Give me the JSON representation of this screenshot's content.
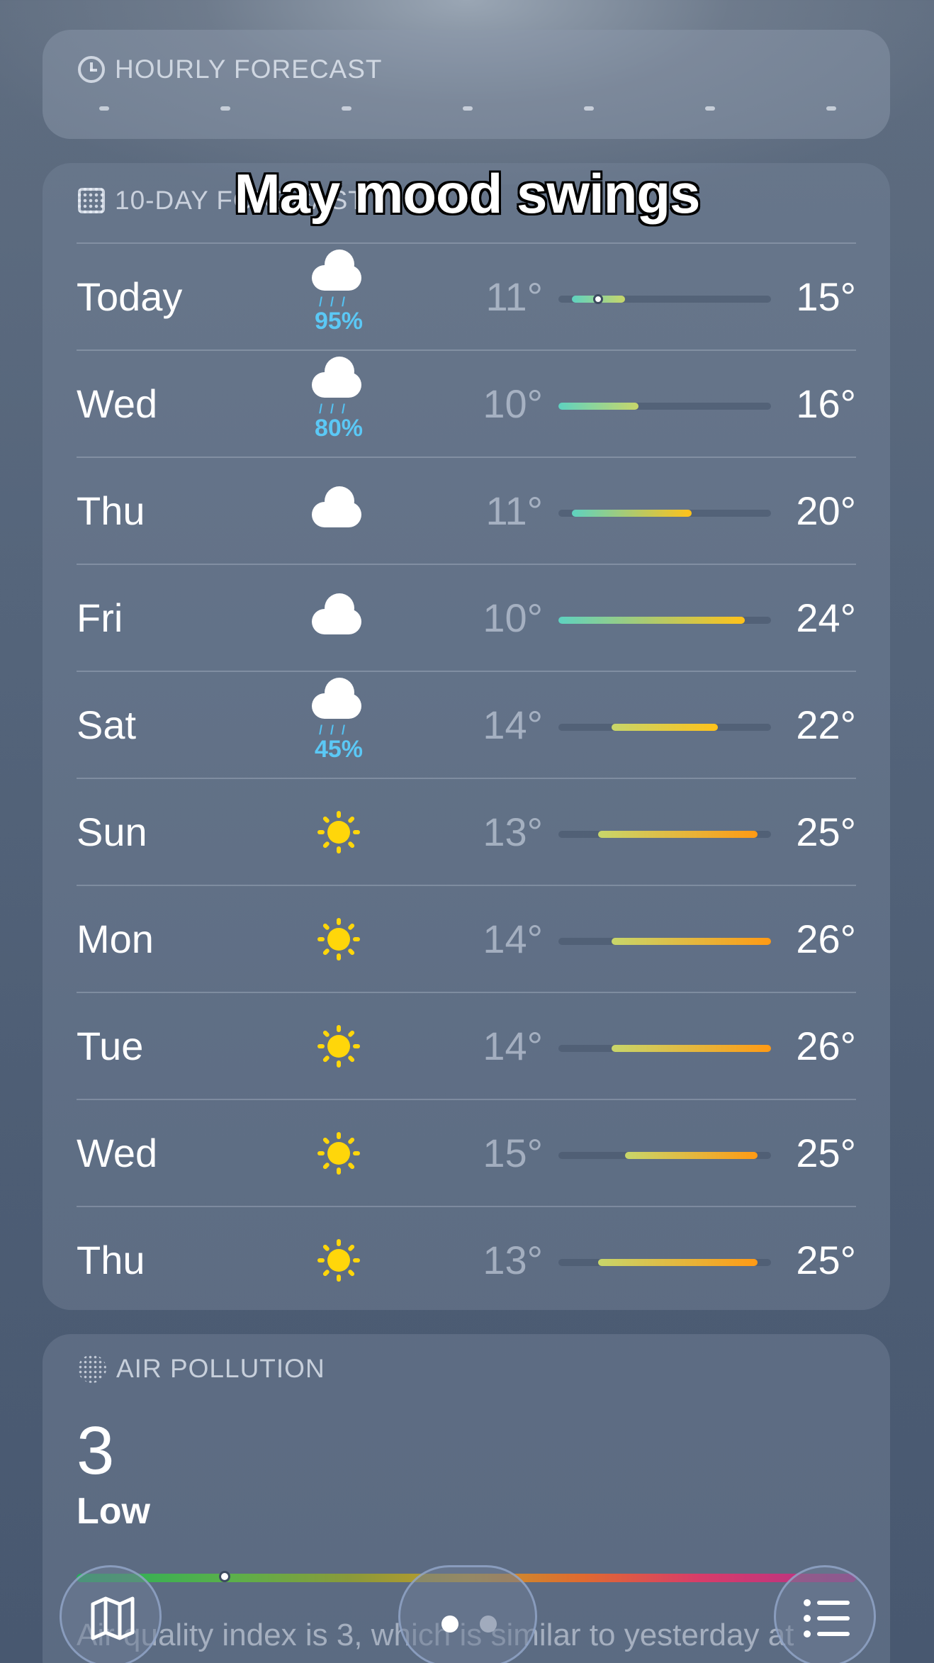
{
  "overlay": {
    "caption": "May mood swings"
  },
  "hourly": {
    "header": "HOURLY FORECAST",
    "icon": "clock-icon"
  },
  "daily": {
    "header": "10-DAY FORECAST",
    "icon": "calendar-icon",
    "scale": {
      "min": 10,
      "max": 26
    },
    "days": [
      {
        "day": "Today",
        "icon": "cloud-rain-icon",
        "precip": "95%",
        "low": "11°",
        "high": "15°",
        "low_value": 11,
        "high_value": 15,
        "current": 13
      },
      {
        "day": "Wed",
        "icon": "cloud-rain-icon",
        "precip": "80%",
        "low": "10°",
        "high": "16°",
        "low_value": 10,
        "high_value": 16
      },
      {
        "day": "Thu",
        "icon": "cloud-icon",
        "precip": "",
        "low": "11°",
        "high": "20°",
        "low_value": 11,
        "high_value": 20
      },
      {
        "day": "Fri",
        "icon": "cloud-icon",
        "precip": "",
        "low": "10°",
        "high": "24°",
        "low_value": 10,
        "high_value": 24
      },
      {
        "day": "Sat",
        "icon": "cloud-rain-icon",
        "precip": "45%",
        "low": "14°",
        "high": "22°",
        "low_value": 14,
        "high_value": 22
      },
      {
        "day": "Sun",
        "icon": "sun-icon",
        "precip": "",
        "low": "13°",
        "high": "25°",
        "low_value": 13,
        "high_value": 25
      },
      {
        "day": "Mon",
        "icon": "sun-icon",
        "precip": "",
        "low": "14°",
        "high": "26°",
        "low_value": 14,
        "high_value": 26
      },
      {
        "day": "Tue",
        "icon": "sun-icon",
        "precip": "",
        "low": "14°",
        "high": "26°",
        "low_value": 14,
        "high_value": 26
      },
      {
        "day": "Wed",
        "icon": "sun-icon",
        "precip": "",
        "low": "15°",
        "high": "25°",
        "low_value": 15,
        "high_value": 25
      },
      {
        "day": "Thu",
        "icon": "sun-icon",
        "precip": "",
        "low": "13°",
        "high": "25°",
        "low_value": 13,
        "high_value": 25
      }
    ]
  },
  "air": {
    "header": "AIR POLLUTION",
    "icon": "air-dots-icon",
    "value": "3",
    "level": "Low",
    "marker_fraction": 0.19,
    "description": "Air quality index is 3, which is similar to yesterday at"
  },
  "bottom": {
    "map_icon": "map-icon",
    "list_icon": "list-icon",
    "pages": 2,
    "active_page": 0
  },
  "colors": {
    "cool": "#5ed2c0",
    "mild": "#c8d66a",
    "warm": "#ffc21a",
    "hot": "#ff9a14",
    "precip": "#5bc8f5",
    "sun": "#ffd60a"
  }
}
